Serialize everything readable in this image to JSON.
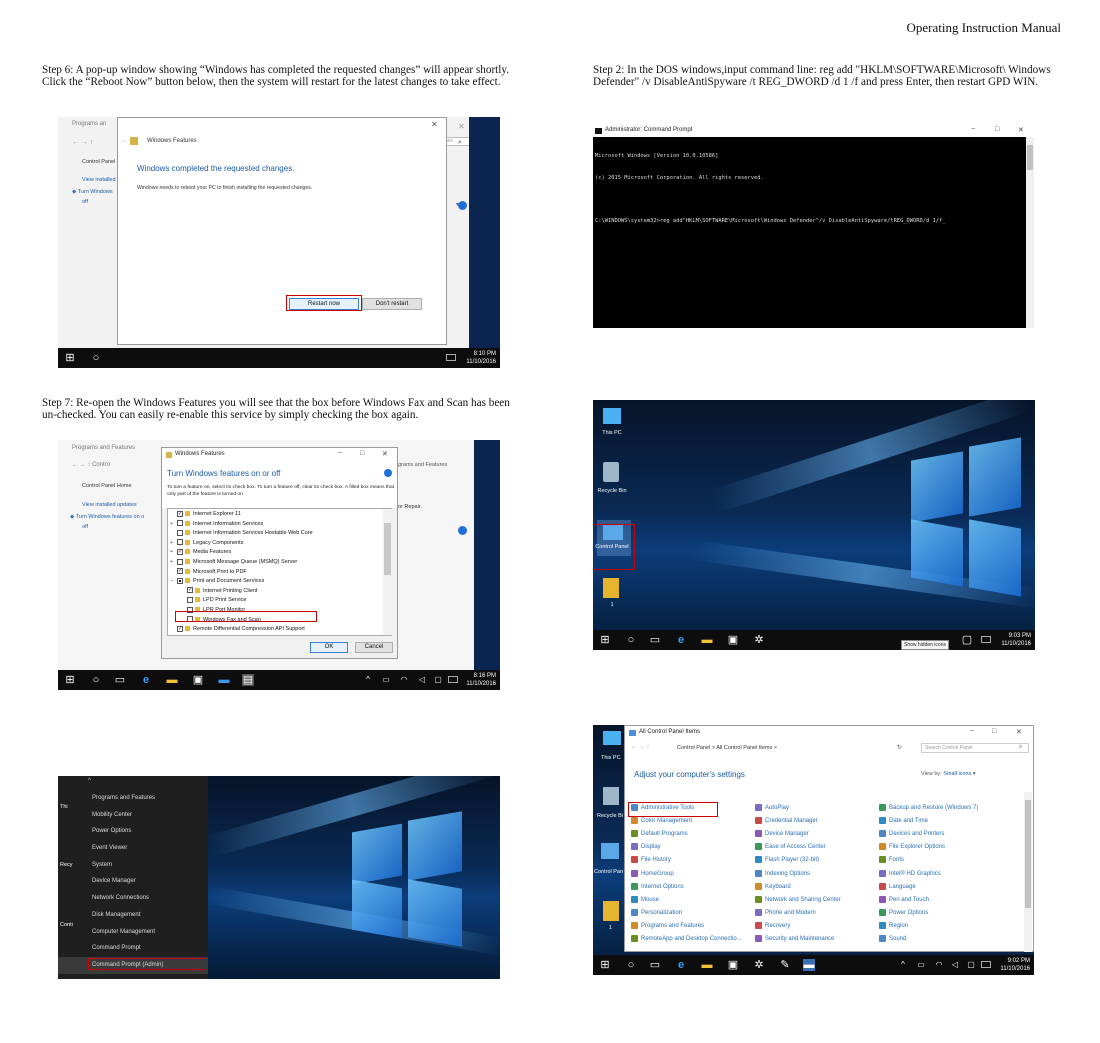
{
  "header": "Operating Instruction Manual",
  "steps": {
    "step6": "Step 6: A pop-up window showing “Windows has completed the requested changes” will appear shortly. Click the “Reboot Now” button below, then the system will restart for the latest changes to take effect.",
    "step2": "Step 2: In the DOS windows,input command line: reg add \"HKLM\\SOFTWARE\\Microsoft\\ Windows Defender\" /v DisableAntiSpyware /t REG_DWORD /d 1 /f and press Enter, then restart GPD WIN.",
    "step7": "Step 7: Re-open the Windows Features you will see that the box before Windows Fax and Scan has been un-checked. You can easily re-enable this service by simply checking the box again."
  },
  "shot1": {
    "bg_title": "Programs an",
    "bg_side": [
      "Control Panel",
      "View installed",
      "Turn Windows",
      "off"
    ],
    "bg_search_hint": "ass",
    "dialog_title": "Windows Features",
    "heading": "Windows completed the requested changes.",
    "message": "Windows needs to reboot your PC to finish installing the requested changes.",
    "restart": "Restart now",
    "dont_restart": "Don't restart",
    "time": "8:10 PM",
    "date": "11/10/2016"
  },
  "shot2": {
    "title": "Administrator: Command Prompt",
    "lines": [
      "Microsoft Windows [Version 10.0.10586]",
      "(c) 2015 Microsoft Corporation. All rights reserved.",
      "",
      "C:\\WINDOWS\\system32>reg add\"HKLM\\SOFTWARE\\Microsoft\\Windows Defender\"/v DisableAntiSpyware/tREG_DWORD/d 1/f_"
    ]
  },
  "shot3": {
    "bg_title": "Programs and Features",
    "bg_crumb": "Contro",
    "bg_side": [
      "Control Panel Home",
      "View installed updates",
      "Turn Windows features on o",
      "off"
    ],
    "bg_right": [
      "grams and Features",
      "or Repair."
    ],
    "dialog_title": "Windows Features",
    "heading": "Turn Windows features on or off",
    "desc": "To turn a feature on, select its check box. To turn a feature off, clear its check box. A filled box means that only part of the feature is turned on.",
    "features": [
      {
        "label": "Internet Explorer 11",
        "state": "checked",
        "indent": 0,
        "expand": ""
      },
      {
        "label": "Internet Information Services",
        "state": "unchecked",
        "indent": 0,
        "expand": "+"
      },
      {
        "label": "Internet Information Services Hostable Web Core",
        "state": "unchecked",
        "indent": 0,
        "expand": ""
      },
      {
        "label": "Legacy Components",
        "state": "unchecked",
        "indent": 0,
        "expand": "+"
      },
      {
        "label": "Media Features",
        "state": "checked",
        "indent": 0,
        "expand": "+"
      },
      {
        "label": "Microsoft Message Queue (MSMQ) Server",
        "state": "unchecked",
        "indent": 0,
        "expand": "+"
      },
      {
        "label": "Microsoft Print to PDF",
        "state": "checked",
        "indent": 0,
        "expand": ""
      },
      {
        "label": "Print and Document Services",
        "state": "partial",
        "indent": 0,
        "expand": "−"
      },
      {
        "label": "Internet Printing Client",
        "state": "checked",
        "indent": 1,
        "expand": ""
      },
      {
        "label": "LPD Print Service",
        "state": "unchecked",
        "indent": 1,
        "expand": ""
      },
      {
        "label": "LPR Port Monitor",
        "state": "unchecked",
        "indent": 1,
        "expand": ""
      },
      {
        "label": "Windows Fax and Scan",
        "state": "unchecked",
        "indent": 1,
        "expand": ""
      },
      {
        "label": "Remote Differential Compression API Support",
        "state": "checked",
        "indent": 0,
        "expand": ""
      }
    ],
    "ok": "OK",
    "cancel": "Cancel",
    "time": "8:16 PM",
    "date": "11/10/2016"
  },
  "shot4": {
    "icons": [
      "This PC",
      "Recycle Bin",
      "Control Panel"
    ],
    "tooltip": "Show hidden icons",
    "time": "9:03 PM",
    "date": "11/10/2016"
  },
  "shot5": {
    "menu": [
      "Programs and Features",
      "Mobility Center",
      "Power Options",
      "Event Viewer",
      "System",
      "Device Manager",
      "Network Connections",
      "Disk Management",
      "Computer Management",
      "Command Prompt",
      "Command Prompt (Admin)"
    ],
    "desk_labels": [
      "Thi",
      "Recy",
      "Conti"
    ]
  },
  "shot6": {
    "title": "All Control Panel Items",
    "breadcrumb": "Control Panel  >  All Control Panel Items  >",
    "search": "Search Control Panel",
    "heading": "Adjust your computer's settings",
    "viewby_label": "View by:",
    "viewby_value": "Small icons",
    "items": [
      [
        "Administrative Tools",
        "AutoPlay",
        "Backup and Restore (Windows 7)"
      ],
      [
        "Color Management",
        "Credential Manager",
        "Date and Time"
      ],
      [
        "Default Programs",
        "Device Manager",
        "Devices and Printers"
      ],
      [
        "Display",
        "Ease of Access Center",
        "File Explorer Options"
      ],
      [
        "File History",
        "Flash Player (32-bit)",
        "Fonts"
      ],
      [
        "HomeGroup",
        "Indexing Options",
        "Intel® HD Graphics"
      ],
      [
        "Internet Options",
        "Keyboard",
        "Language"
      ],
      [
        "Mouse",
        "Network and Sharing Center",
        "Pen and Touch"
      ],
      [
        "Personalization",
        "Phone and Modem",
        "Power Options"
      ],
      [
        "Programs and Features",
        "Recovery",
        "Region"
      ],
      [
        "RemoteApp and Desktop Connectio...",
        "Security and Maintenance",
        "Sound"
      ]
    ],
    "desk_labels": [
      "This PC",
      "Recycle Bi",
      "Control Pan",
      "1"
    ],
    "time": "9:02 PM",
    "date": "11/10/2016"
  },
  "colors": {
    "accent": "#1a5aa8",
    "highlight": "#c00000",
    "taskbar": "#0d0d0d"
  }
}
